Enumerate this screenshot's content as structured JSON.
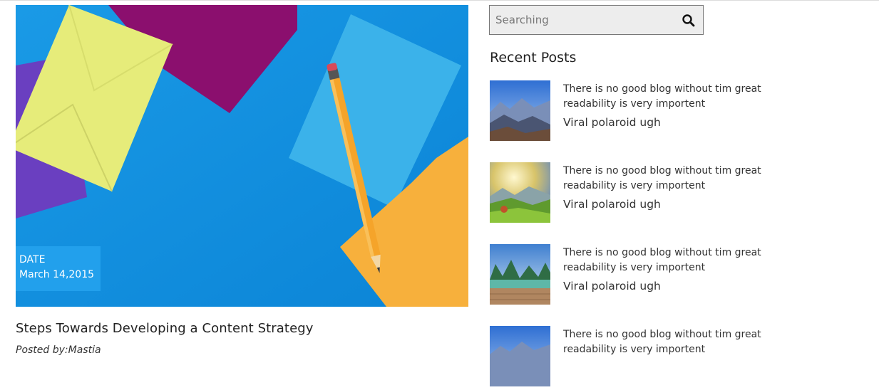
{
  "feature": {
    "date_label": "DATE",
    "date_value": "March 14,2015",
    "title": "Steps Towards Developing a Content Strategy",
    "posted_by": "Posted by:Mastia"
  },
  "search": {
    "placeholder": "Searching",
    "icon": "search-icon"
  },
  "sidebar": {
    "heading": "Recent Posts",
    "posts": [
      {
        "text": "There is no good blog without tim great readability is very importent",
        "sub": "Viral polaroid ugh"
      },
      {
        "text": "There is no good blog without tim great readability is very importent",
        "sub": "Viral polaroid ugh"
      },
      {
        "text": "There is no good blog without tim great readability is very importent",
        "sub": "Viral polaroid ugh"
      },
      {
        "text": "There is no good blog without tim great readability is very importent",
        "sub": ""
      }
    ]
  },
  "colors": {
    "date_box": "#22a0ec",
    "feature_bg": "#0d8fdc"
  }
}
